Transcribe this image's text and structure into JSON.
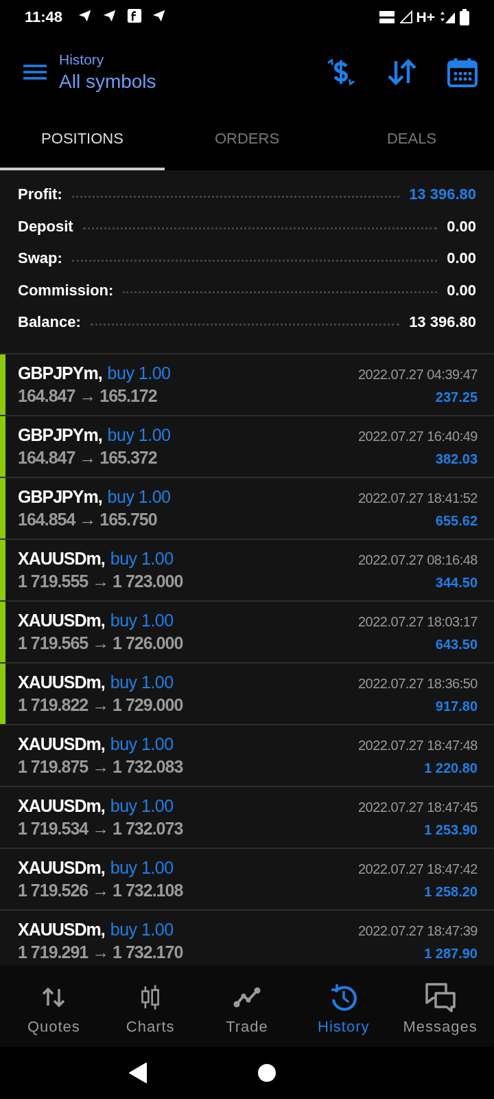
{
  "status_bar": {
    "time": "11:48",
    "network": "H+"
  },
  "header": {
    "subtitle": "History",
    "title": "All symbols"
  },
  "tabs": [
    {
      "label": "POSITIONS",
      "selected": true
    },
    {
      "label": "ORDERS",
      "selected": false
    },
    {
      "label": "DEALS",
      "selected": false
    }
  ],
  "summary": [
    {
      "label": "Profit:",
      "value": "13 396.80",
      "kind": "accent"
    },
    {
      "label": "Deposit",
      "value": "0.00",
      "kind": "plain"
    },
    {
      "label": "Swap:",
      "value": "0.00",
      "kind": "plain"
    },
    {
      "label": "Commission:",
      "value": "0.00",
      "kind": "plain"
    },
    {
      "label": "Balance:",
      "value": "13 396.80",
      "kind": "plain"
    }
  ],
  "positions": [
    {
      "symbol": "GBPJPYm,",
      "side": "buy 1.00",
      "prices": "164.847 → 165.172",
      "time": "2022.07.27 04:39:47",
      "profit": "237.25",
      "marked": true
    },
    {
      "symbol": "GBPJPYm,",
      "side": "buy 1.00",
      "prices": "164.847 → 165.372",
      "time": "2022.07.27 16:40:49",
      "profit": "382.03",
      "marked": true
    },
    {
      "symbol": "GBPJPYm,",
      "side": "buy 1.00",
      "prices": "164.854 → 165.750",
      "time": "2022.07.27 18:41:52",
      "profit": "655.62",
      "marked": true
    },
    {
      "symbol": "XAUUSDm,",
      "side": "buy 1.00",
      "prices": "1 719.555 → 1 723.000",
      "time": "2022.07.27 08:16:48",
      "profit": "344.50",
      "marked": true
    },
    {
      "symbol": "XAUUSDm,",
      "side": "buy 1.00",
      "prices": "1 719.565 → 1 726.000",
      "time": "2022.07.27 18:03:17",
      "profit": "643.50",
      "marked": true
    },
    {
      "symbol": "XAUUSDm,",
      "side": "buy 1.00",
      "prices": "1 719.822 → 1 729.000",
      "time": "2022.07.27 18:36:50",
      "profit": "917.80",
      "marked": true
    },
    {
      "symbol": "XAUUSDm,",
      "side": "buy 1.00",
      "prices": "1 719.875 → 1 732.083",
      "time": "2022.07.27 18:47:48",
      "profit": "1 220.80",
      "marked": false
    },
    {
      "symbol": "XAUUSDm,",
      "side": "buy 1.00",
      "prices": "1 719.534 → 1 732.073",
      "time": "2022.07.27 18:47:45",
      "profit": "1 253.90",
      "marked": false
    },
    {
      "symbol": "XAUUSDm,",
      "side": "buy 1.00",
      "prices": "1 719.526 → 1 732.108",
      "time": "2022.07.27 18:47:42",
      "profit": "1 258.20",
      "marked": false
    },
    {
      "symbol": "XAUUSDm,",
      "side": "buy 1.00",
      "prices": "1 719.291 → 1 732.170",
      "time": "2022.07.27 18:47:39",
      "profit": "1 287.90",
      "marked": false
    }
  ],
  "bottom_nav": [
    {
      "label": "Quotes",
      "kind": "quotes",
      "selected": false
    },
    {
      "label": "Charts",
      "kind": "charts",
      "selected": false
    },
    {
      "label": "Trade",
      "kind": "trade",
      "selected": false
    },
    {
      "label": "History",
      "kind": "history",
      "selected": true
    },
    {
      "label": "Messages",
      "kind": "messages",
      "selected": false
    }
  ]
}
